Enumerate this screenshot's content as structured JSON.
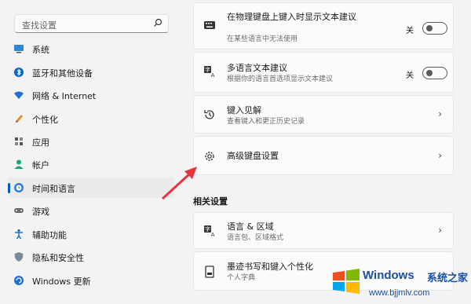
{
  "search": {
    "placeholder": "查找设置"
  },
  "sidebar": {
    "items": [
      {
        "label": "系统",
        "icon": "monitor-icon"
      },
      {
        "label": "蓝牙和其他设备",
        "icon": "bluetooth-icon"
      },
      {
        "label": "网络 & Internet",
        "icon": "wifi-icon"
      },
      {
        "label": "个性化",
        "icon": "pencil-icon"
      },
      {
        "label": "应用",
        "icon": "apps-icon"
      },
      {
        "label": "帐户",
        "icon": "person-icon"
      },
      {
        "label": "时间和语言",
        "icon": "globe-clock-icon",
        "active": true
      },
      {
        "label": "游戏",
        "icon": "game-controller-icon"
      },
      {
        "label": "辅助功能",
        "icon": "accessibility-icon"
      },
      {
        "label": "隐私和安全性",
        "icon": "shield-icon"
      },
      {
        "label": "Windows 更新",
        "icon": "update-icon"
      }
    ]
  },
  "main": {
    "cards": [
      {
        "title": "在物理键盘上键入时显示文本建议",
        "subtitle": "在某些语言中无法使用",
        "icon": "keyboard-icon",
        "toggle_label": "关",
        "toggle_on": false
      },
      {
        "title": "多语言文本建议",
        "subtitle": "根据你的语言首选项显示文本建议",
        "icon": "language-icon",
        "toggle_label": "关",
        "toggle_on": false
      },
      {
        "title": "键入见解",
        "subtitle": "查看键入和更正历史记录",
        "icon": "history-icon"
      },
      {
        "title": "高级键盘设置",
        "subtitle": "",
        "icon": "gear-icon"
      }
    ],
    "related_heading": "相关设置",
    "related_cards": [
      {
        "title": "语言 & 区域",
        "subtitle": "语言包、区域格式",
        "icon": "language-icon"
      },
      {
        "title": "墨迹书写和键入个性化",
        "subtitle": "个人字典",
        "icon": "notebook-icon"
      }
    ]
  },
  "watermark": {
    "brand": "Windows",
    "brand_cn": "系统之家",
    "url": "www.bjjmlv.com"
  },
  "colors": {
    "accent": "#005fb8",
    "arrow": "#e8343f",
    "watermark": "#1a4fa3"
  }
}
